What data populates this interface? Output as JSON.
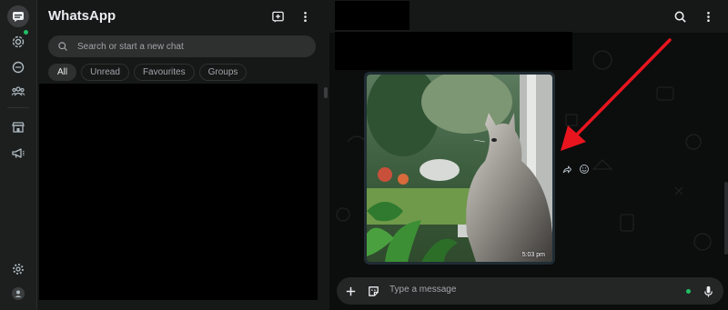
{
  "app": {
    "title": "WhatsApp"
  },
  "rail": {
    "items": [
      {
        "icon": "chats-icon",
        "active": true
      },
      {
        "icon": "status-icon",
        "badge": "green-dot"
      },
      {
        "icon": "channels-icon"
      },
      {
        "icon": "communities-icon"
      },
      {
        "icon": "business-tools-icon"
      },
      {
        "icon": "advertise-icon"
      },
      {
        "icon": "settings-icon"
      },
      {
        "icon": "profile-icon"
      }
    ]
  },
  "search": {
    "placeholder": "Search or start a new chat"
  },
  "filters": {
    "all": "All",
    "unread": "Unread",
    "favourites": "Favourites",
    "groups": "Groups"
  },
  "message": {
    "time": "5:03 pm",
    "image_alt": "cat-by-window-photo"
  },
  "composer": {
    "placeholder": "Type a message"
  },
  "colors": {
    "accent": "#21c063",
    "arrow": "#e8151f",
    "panel": "#161717",
    "rail": "#1d1f1f"
  }
}
